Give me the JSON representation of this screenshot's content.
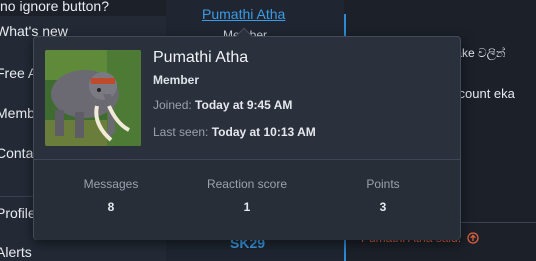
{
  "thread": {
    "title": "no ignore button?"
  },
  "sidebar": {
    "items": [
      {
        "label": "What's new"
      },
      {
        "label": "Free A"
      },
      {
        "label": "Memb"
      },
      {
        "label": "Conta"
      },
      {
        "label": "Profile"
      },
      {
        "label": "Alerts"
      }
    ]
  },
  "post": {
    "author_link": "Pumathi Atha",
    "author_role": "Member",
    "snippet1": "fake වලින් ",
    "snippet2": "ccount eka"
  },
  "next_post": {
    "author": "SK29",
    "quote_attribution": "Pumathi Atha said:"
  },
  "tooltip": {
    "name": "Pumathi Atha",
    "role": "Member",
    "joined_label": "Joined:",
    "joined_value": "Today at 9:45 AM",
    "last_seen_label": "Last seen:",
    "last_seen_value": "Today at 10:13 AM",
    "stats": [
      {
        "label": "Messages",
        "value": "8"
      },
      {
        "label": "Reaction score",
        "value": "1"
      },
      {
        "label": "Points",
        "value": "3"
      }
    ]
  },
  "icons": {
    "sidebar_chevron": "chevron-down-icon",
    "quote_jump": "arrow-up-circle-icon"
  },
  "colors": {
    "link": "#3b9be6",
    "quote": "#e0613f",
    "accent_line": "#2d8bd6"
  }
}
